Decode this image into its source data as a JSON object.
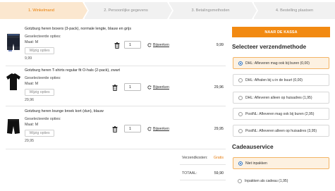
{
  "steps": [
    {
      "label": "1. Winkelmand",
      "active": true
    },
    {
      "label": "2. Persoonlijke gegevens",
      "active": false
    },
    {
      "label": "3. Betalingsmethoden",
      "active": false
    },
    {
      "label": "4. Bestelling plaatsen",
      "active": false
    }
  ],
  "items": [
    {
      "title": "Gotzburg heren boxers (3-pack), normale lengte, blauw en grijs",
      "options_label": "Geselecteerde opties:",
      "size": "Maat: M",
      "change_label": "Wijzig opties",
      "unit_price": "9,99",
      "quantity": "1",
      "update_label": "Bijwerken",
      "line_total": "9,99",
      "thumb_icon": "boxers-3pack-image"
    },
    {
      "title": "Gotzburg heren T-shirts regular fit O-hals (2-pack), zwart",
      "options_label": "Geselecteerde opties:",
      "size": "Maat: M",
      "change_label": "Wijzig opties",
      "unit_price": "29,96",
      "quantity": "1",
      "update_label": "Bijwerken",
      "line_total": "29,96",
      "thumb_icon": "tshirt-image"
    },
    {
      "title": "Gotzburg heren lounge broek kort (dun), blauw",
      "options_label": "Geselecteerde opties:",
      "size": "Maat: M",
      "change_label": "Wijzig opties",
      "unit_price": "29,95",
      "quantity": "1",
      "update_label": "Bijwerken",
      "line_total": "29,95",
      "thumb_icon": "shorts-image"
    }
  ],
  "summary": {
    "shipping_label": "Verzendkosten:",
    "shipping_value": "Gratis",
    "total_label": "TOTAAL:",
    "total_value": "59,90"
  },
  "checkout_label": "NAAR DE KASSA",
  "shipping": {
    "title": "Selecteer verzendmethode",
    "options": [
      {
        "label": "DHL: Afleveren mag ook bij buren (0,00)",
        "selected": true
      },
      {
        "label": "DHL: Afhalen bij u in de buurt (0,00)",
        "selected": false
      },
      {
        "label": "DHL: Afleveren alleen op huisadres (1,95)",
        "selected": false
      },
      {
        "label": "PostNL: Afleveren mag ook bij buren (2,95)",
        "selected": false
      },
      {
        "label": "PostNL: Afleveren alleen op huisadres (3,95)",
        "selected": false
      }
    ]
  },
  "gift": {
    "title": "Cadeauservice",
    "options": [
      {
        "label": "Niet inpakken",
        "selected": true
      },
      {
        "label": "Inpakken als cadeau (1,95)",
        "selected": false
      }
    ]
  },
  "colors": {
    "accent": "#f28a12",
    "active_step_bg": "#fbe7cf",
    "active_step_text": "#e97f06",
    "selected_option_bg": "#fdf1e1",
    "free_shipping": "#e67e12"
  }
}
